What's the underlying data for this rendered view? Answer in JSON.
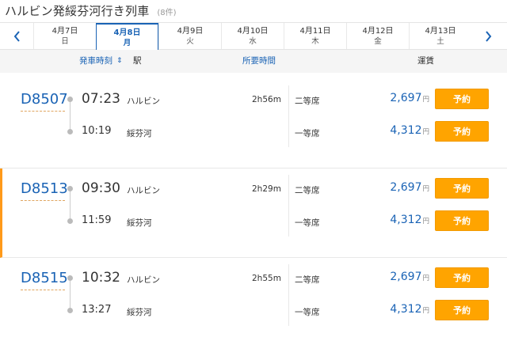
{
  "header": {
    "title": "ハルビン発綏芬河行き列車",
    "count": "(8件)"
  },
  "date_nav": {
    "prev_icon": "chevron-left-icon",
    "next_icon": "chevron-right-icon",
    "dates": [
      {
        "date": "4月7日",
        "dow": "日"
      },
      {
        "date": "4月8日",
        "dow": "月",
        "active": true
      },
      {
        "date": "4月9日",
        "dow": "火"
      },
      {
        "date": "4月10日",
        "dow": "水"
      },
      {
        "date": "4月11日",
        "dow": "木"
      },
      {
        "date": "4月12日",
        "dow": "金"
      },
      {
        "date": "4月13日",
        "dow": "土"
      }
    ]
  },
  "columns": {
    "depart": "発車時刻",
    "sort_icon": "⇕",
    "station": "駅",
    "duration": "所要時間",
    "fare": "運賃"
  },
  "trains": [
    {
      "number": "D8507",
      "dep_time": "07:23",
      "dep_station": "ハルビン",
      "arr_time": "10:19",
      "arr_station": "綏芬河",
      "duration": "2h56m",
      "seats": [
        {
          "class": "二等席",
          "fare": "2,697",
          "yen": "円",
          "button": "予約"
        },
        {
          "class": "一等席",
          "fare": "4,312",
          "yen": "円",
          "button": "予約"
        }
      ]
    },
    {
      "number": "D8513",
      "highlight": true,
      "dep_time": "09:30",
      "dep_station": "ハルビン",
      "arr_time": "11:59",
      "arr_station": "綏芬河",
      "duration": "2h29m",
      "seats": [
        {
          "class": "二等席",
          "fare": "2,697",
          "yen": "円",
          "button": "予約"
        },
        {
          "class": "一等席",
          "fare": "4,312",
          "yen": "円",
          "button": "予約"
        }
      ]
    },
    {
      "number": "D8515",
      "dep_time": "10:32",
      "dep_station": "ハルビン",
      "arr_time": "13:27",
      "arr_station": "綏芬河",
      "duration": "2h55m",
      "seats": [
        {
          "class": "二等席",
          "fare": "2,697",
          "yen": "円",
          "button": "予約"
        },
        {
          "class": "一等席",
          "fare": "4,312",
          "yen": "円",
          "button": "予約"
        }
      ]
    }
  ],
  "colors": {
    "accent_blue": "#1a63b5",
    "book_orange": "#ffa400",
    "highlight_orange": "#ff9a1a"
  }
}
